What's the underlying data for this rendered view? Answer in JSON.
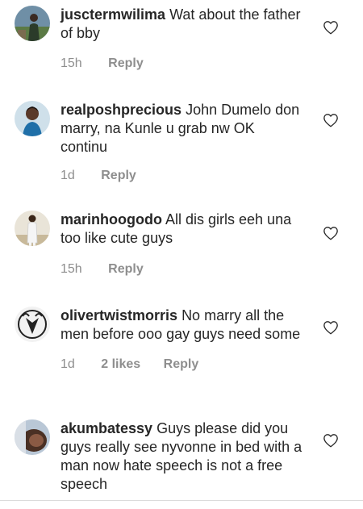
{
  "comments": [
    {
      "username": "jusctermwilima",
      "text": "Wat about the father of bby",
      "time": "15h",
      "likes": "",
      "reply": "Reply",
      "avatar_icon": "avatar-person-outdoor-icon"
    },
    {
      "username": "realposhprecious",
      "text": "John Dumelo don marry, na Kunle u grab nw OK continu",
      "time": "1d",
      "likes": "",
      "reply": "Reply",
      "avatar_icon": "avatar-woman-icon"
    },
    {
      "username": "marinhoogodo",
      "text": "All dis girls eeh una too like cute guys",
      "time": "15h",
      "likes": "",
      "reply": "Reply",
      "avatar_icon": "avatar-man-white-outfit-icon"
    },
    {
      "username": "olivertwistmorris",
      "text": "No marry all the men before ooo gay guys need some",
      "time": "1d",
      "likes": "2 likes",
      "reply": "Reply",
      "avatar_icon": "avatar-goat-emblem-icon"
    },
    {
      "username": "akumbatessy",
      "text": "Guys please did you guys really see nyvonne in bed with a man now hate speech is not a free speech",
      "time": "",
      "likes": "",
      "reply": "",
      "avatar_icon": "avatar-selfie-icon"
    }
  ],
  "colors": {
    "text": "#262626",
    "secondary": "#8e8e8e",
    "divider": "#dbdbdb",
    "heart_outline": "#262626"
  }
}
